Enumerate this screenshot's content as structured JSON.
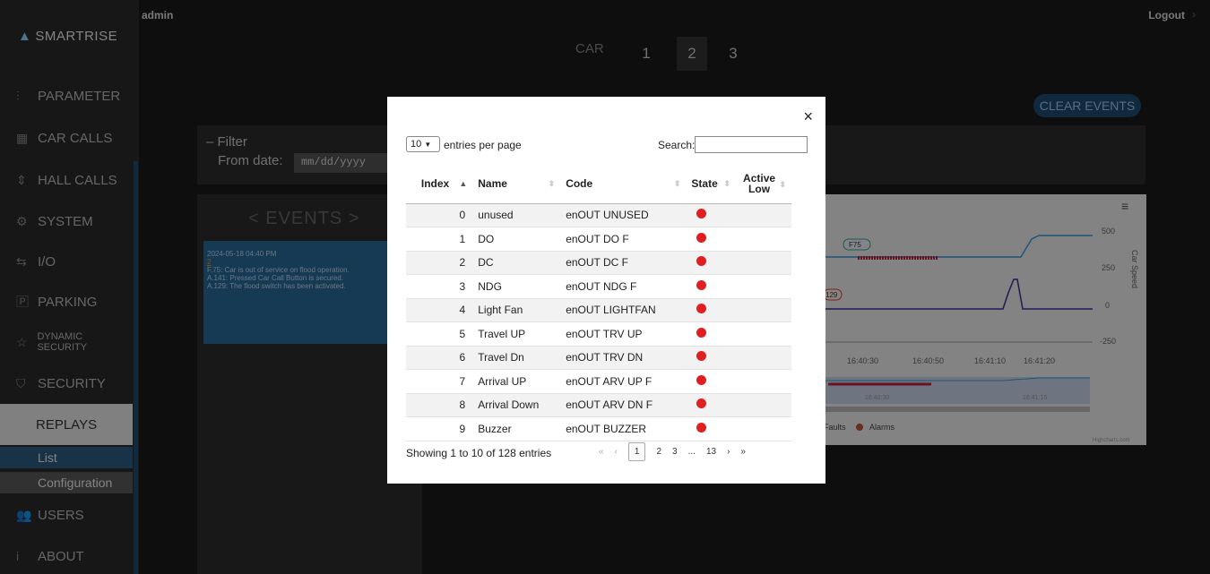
{
  "header": {
    "user": "admin",
    "logout": "Logout"
  },
  "sidebar": {
    "logo": "SMARTRISE",
    "items": [
      {
        "label": "PARAMETER"
      },
      {
        "label": "CAR CALLS"
      },
      {
        "label": "HALL CALLS"
      },
      {
        "label": "SYSTEM"
      },
      {
        "label": "I/O"
      },
      {
        "label": "PARKING"
      },
      {
        "label": "DYNAMIC SECURITY"
      },
      {
        "label": "SECURITY"
      }
    ],
    "replays": "REPLAYS",
    "replay_sub": [
      "List",
      "Configuration"
    ],
    "bottom_items": [
      {
        "label": "USERS"
      },
      {
        "label": "ABOUT"
      }
    ]
  },
  "carbar": {
    "label": "CAR",
    "cars": [
      "1",
      "2",
      "3"
    ],
    "selected": "2"
  },
  "clear_events": "CLEAR EVENTS",
  "filter": {
    "title": "Filter",
    "from_label": "From date:",
    "from_placeholder": "mm/dd/yyyy"
  },
  "events": {
    "title": "<   EVENTS   >",
    "card": {
      "date": "2024-05-18 04:40 PM",
      "number": "2",
      "lines": [
        "F.75: Car is out of service on flood operation.",
        "A.141: Pressed Car Call Button is secured.",
        "A.129: The flood switch has been activated."
      ]
    }
  },
  "chart": {
    "y_ticks": [
      "500",
      "250",
      "0",
      "-250"
    ],
    "y_label": "Car Speed",
    "x_ticks": [
      "16:40:30",
      "16:40:50",
      "16:41:10",
      "16:41:20"
    ],
    "nav_ticks": [
      "16:40:30",
      "16:41:15"
    ],
    "flags": [
      "F75",
      "129"
    ],
    "legend": [
      "Faults",
      "Alarms"
    ],
    "credit": "Highcharts.com"
  },
  "modal": {
    "close": "×",
    "length_value": "10",
    "length_label": "entries per page",
    "search_label": "Search:",
    "columns": [
      "Index",
      "Name",
      "Code",
      "State",
      "Active Low"
    ],
    "rows": [
      {
        "index": "0",
        "name": "unused",
        "code": "enOUT UNUSED"
      },
      {
        "index": "1",
        "name": "DO",
        "code": "enOUT DO F"
      },
      {
        "index": "2",
        "name": "DC",
        "code": "enOUT DC F"
      },
      {
        "index": "3",
        "name": "NDG",
        "code": "enOUT NDG F"
      },
      {
        "index": "4",
        "name": "Light Fan",
        "code": "enOUT LIGHTFAN"
      },
      {
        "index": "5",
        "name": "Travel UP",
        "code": "enOUT TRV UP"
      },
      {
        "index": "6",
        "name": "Travel Dn",
        "code": "enOUT TRV DN"
      },
      {
        "index": "7",
        "name": "Arrival UP",
        "code": "enOUT ARV UP F"
      },
      {
        "index": "8",
        "name": "Arrival Down",
        "code": "enOUT ARV DN F"
      },
      {
        "index": "9",
        "name": "Buzzer",
        "code": "enOUT BUZZER"
      }
    ],
    "state_color": "#e02020",
    "info": "Showing 1 to 10 of 128 entries",
    "pager": {
      "first": "«",
      "prev": "‹",
      "pages": [
        "1",
        "2",
        "3",
        "...",
        "13"
      ],
      "next": "›",
      "last": "»"
    }
  },
  "colors": {
    "accent": "#1f4b73",
    "line_primary": "#3a9ad9",
    "line_secondary": "#3a2f9a",
    "fault": "#c0203a"
  }
}
